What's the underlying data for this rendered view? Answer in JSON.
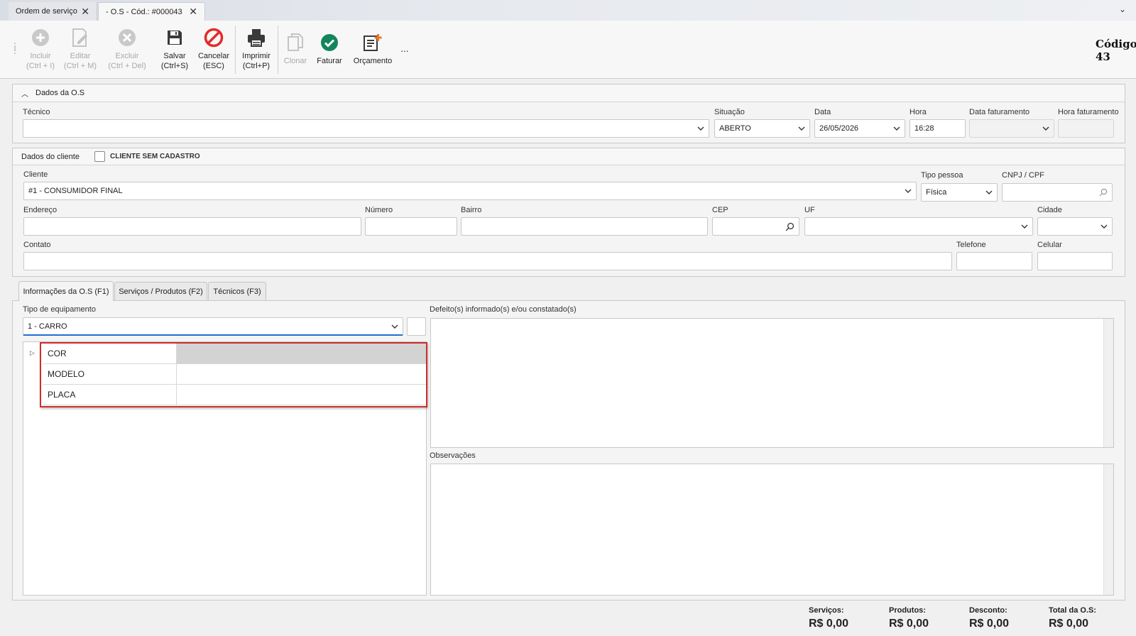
{
  "tabs": [
    {
      "label": "Ordem de serviço"
    },
    {
      "label": "- O.S - Cód.: #000043"
    }
  ],
  "toolbar": {
    "incluir": {
      "label": "Incluir",
      "shortcut": "(Ctrl + I)"
    },
    "editar": {
      "label": "Editar",
      "shortcut": "(Ctrl + M)"
    },
    "excluir": {
      "label": "Excluir",
      "shortcut": "(Ctrl + Del)"
    },
    "salvar": {
      "label": "Salvar",
      "shortcut": "(Ctrl+S)"
    },
    "cancelar": {
      "label": "Cancelar",
      "shortcut": "(ESC)"
    },
    "imprimir": {
      "label": "Imprimir",
      "shortcut": "(Ctrl+P)"
    },
    "clonar": {
      "label": "Clonar"
    },
    "faturar": {
      "label": "Faturar"
    },
    "orcamento": {
      "label": "Orçamento"
    },
    "more": "..."
  },
  "codigo": {
    "label": "Código",
    "value": "43"
  },
  "dados_os": {
    "title": "Dados da O.S",
    "tecnico": {
      "label": "Técnico",
      "value": ""
    },
    "situacao": {
      "label": "Situação",
      "value": "ABERTO"
    },
    "data": {
      "label": "Data",
      "value": "26/05/2026"
    },
    "hora": {
      "label": "Hora",
      "value": "16:28"
    },
    "data_faturamento": {
      "label": "Data faturamento",
      "value": ""
    },
    "hora_faturamento": {
      "label": "Hora faturamento",
      "value": ""
    }
  },
  "cliente_panel": {
    "title": "Dados do cliente",
    "sem_cadastro": "CLIENTE SEM CADASTRO",
    "cliente": {
      "label": "Cliente",
      "value": "#1 - CONSUMIDOR FINAL"
    },
    "tipo_pessoa": {
      "label": "Tipo pessoa",
      "value": "Física"
    },
    "cnpj_cpf": {
      "label": "CNPJ / CPF",
      "value": ""
    },
    "endereco": {
      "label": "Endereço",
      "value": ""
    },
    "numero": {
      "label": "Número",
      "value": ""
    },
    "bairro": {
      "label": "Bairro",
      "value": ""
    },
    "cep": {
      "label": "CEP",
      "value": ""
    },
    "uf": {
      "label": "UF",
      "value": ""
    },
    "cidade": {
      "label": "Cidade",
      "value": ""
    },
    "contato": {
      "label": "Contato",
      "value": ""
    },
    "telefone": {
      "label": "Telefone",
      "value": ""
    },
    "celular": {
      "label": "Celular",
      "value": ""
    }
  },
  "inner_tabs": [
    {
      "label": "Informações da O.S (F1)"
    },
    {
      "label": "Serviços / Produtos (F2)"
    },
    {
      "label": "Técnicos (F3)"
    }
  ],
  "equipamento": {
    "label": "Tipo de equipamento",
    "value": "1 - CARRO",
    "rows": [
      {
        "key": "COR",
        "value": ""
      },
      {
        "key": "MODELO",
        "value": ""
      },
      {
        "key": "PLACA",
        "value": ""
      }
    ]
  },
  "defeitos": {
    "label": "Defeito(s) informado(s) e/ou constatado(s)",
    "value": ""
  },
  "observacoes": {
    "label": "Observações",
    "value": ""
  },
  "totais": {
    "servicos": {
      "label": "Serviços:",
      "value": "R$ 0,00"
    },
    "produtos": {
      "label": "Produtos:",
      "value": "R$ 0,00"
    },
    "desconto": {
      "label": "Desconto:",
      "value": "R$ 0,00"
    },
    "total": {
      "label": "Total da O.S:",
      "value": "R$ 0,00"
    }
  },
  "colors": {
    "accent": "#1f6fd1",
    "highlight": "#d12c2c",
    "faturar": "#14855b",
    "cancel": "#e32b2b"
  }
}
